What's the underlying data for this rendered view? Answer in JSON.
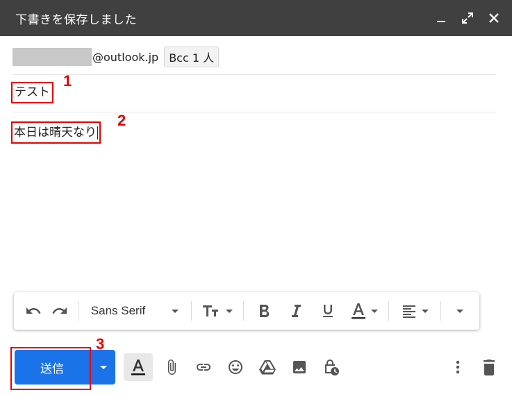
{
  "window": {
    "title": "下書きを保存しました"
  },
  "recipients": {
    "address_suffix": "@outlook.jp",
    "bcc_label": "Bcc 1 人"
  },
  "subject": {
    "value": "テスト"
  },
  "body": {
    "value": "本日は晴天なり"
  },
  "annotations": [
    "1",
    "2",
    "3"
  ],
  "format_toolbar": {
    "font_name": "Sans Serif"
  },
  "send": {
    "label": "送信"
  },
  "colors": {
    "accent": "#1a73e8",
    "titlebar": "#404040",
    "highlight": "#e60000"
  }
}
